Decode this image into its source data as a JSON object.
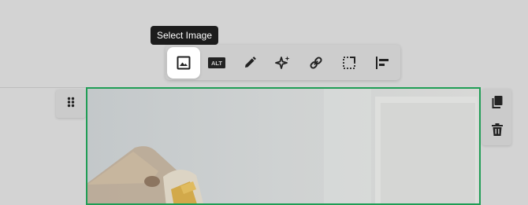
{
  "tooltip": {
    "text": "Select Image"
  },
  "toolbar": {
    "buttons": [
      {
        "name": "select-image",
        "icon": "image-icon",
        "active": true
      },
      {
        "name": "alt-text",
        "icon": "alt-text-icon",
        "label": "ALT"
      },
      {
        "name": "edit",
        "icon": "pencil-icon"
      },
      {
        "name": "ai-generate",
        "icon": "sparkles-icon"
      },
      {
        "name": "link",
        "icon": "link-icon"
      },
      {
        "name": "crop",
        "icon": "crop-icon"
      },
      {
        "name": "align",
        "icon": "align-left-icon"
      }
    ]
  },
  "side_actions": [
    {
      "name": "duplicate",
      "icon": "copy-icon"
    },
    {
      "name": "delete",
      "icon": "trash-icon"
    }
  ],
  "block_handle": {
    "icon": "drag-dots-icon"
  },
  "colors": {
    "overlay_bg": "#d3d3d3",
    "selection_border": "#1f9d55",
    "tooltip_bg": "#1c1c1c",
    "icon": "#222222"
  }
}
